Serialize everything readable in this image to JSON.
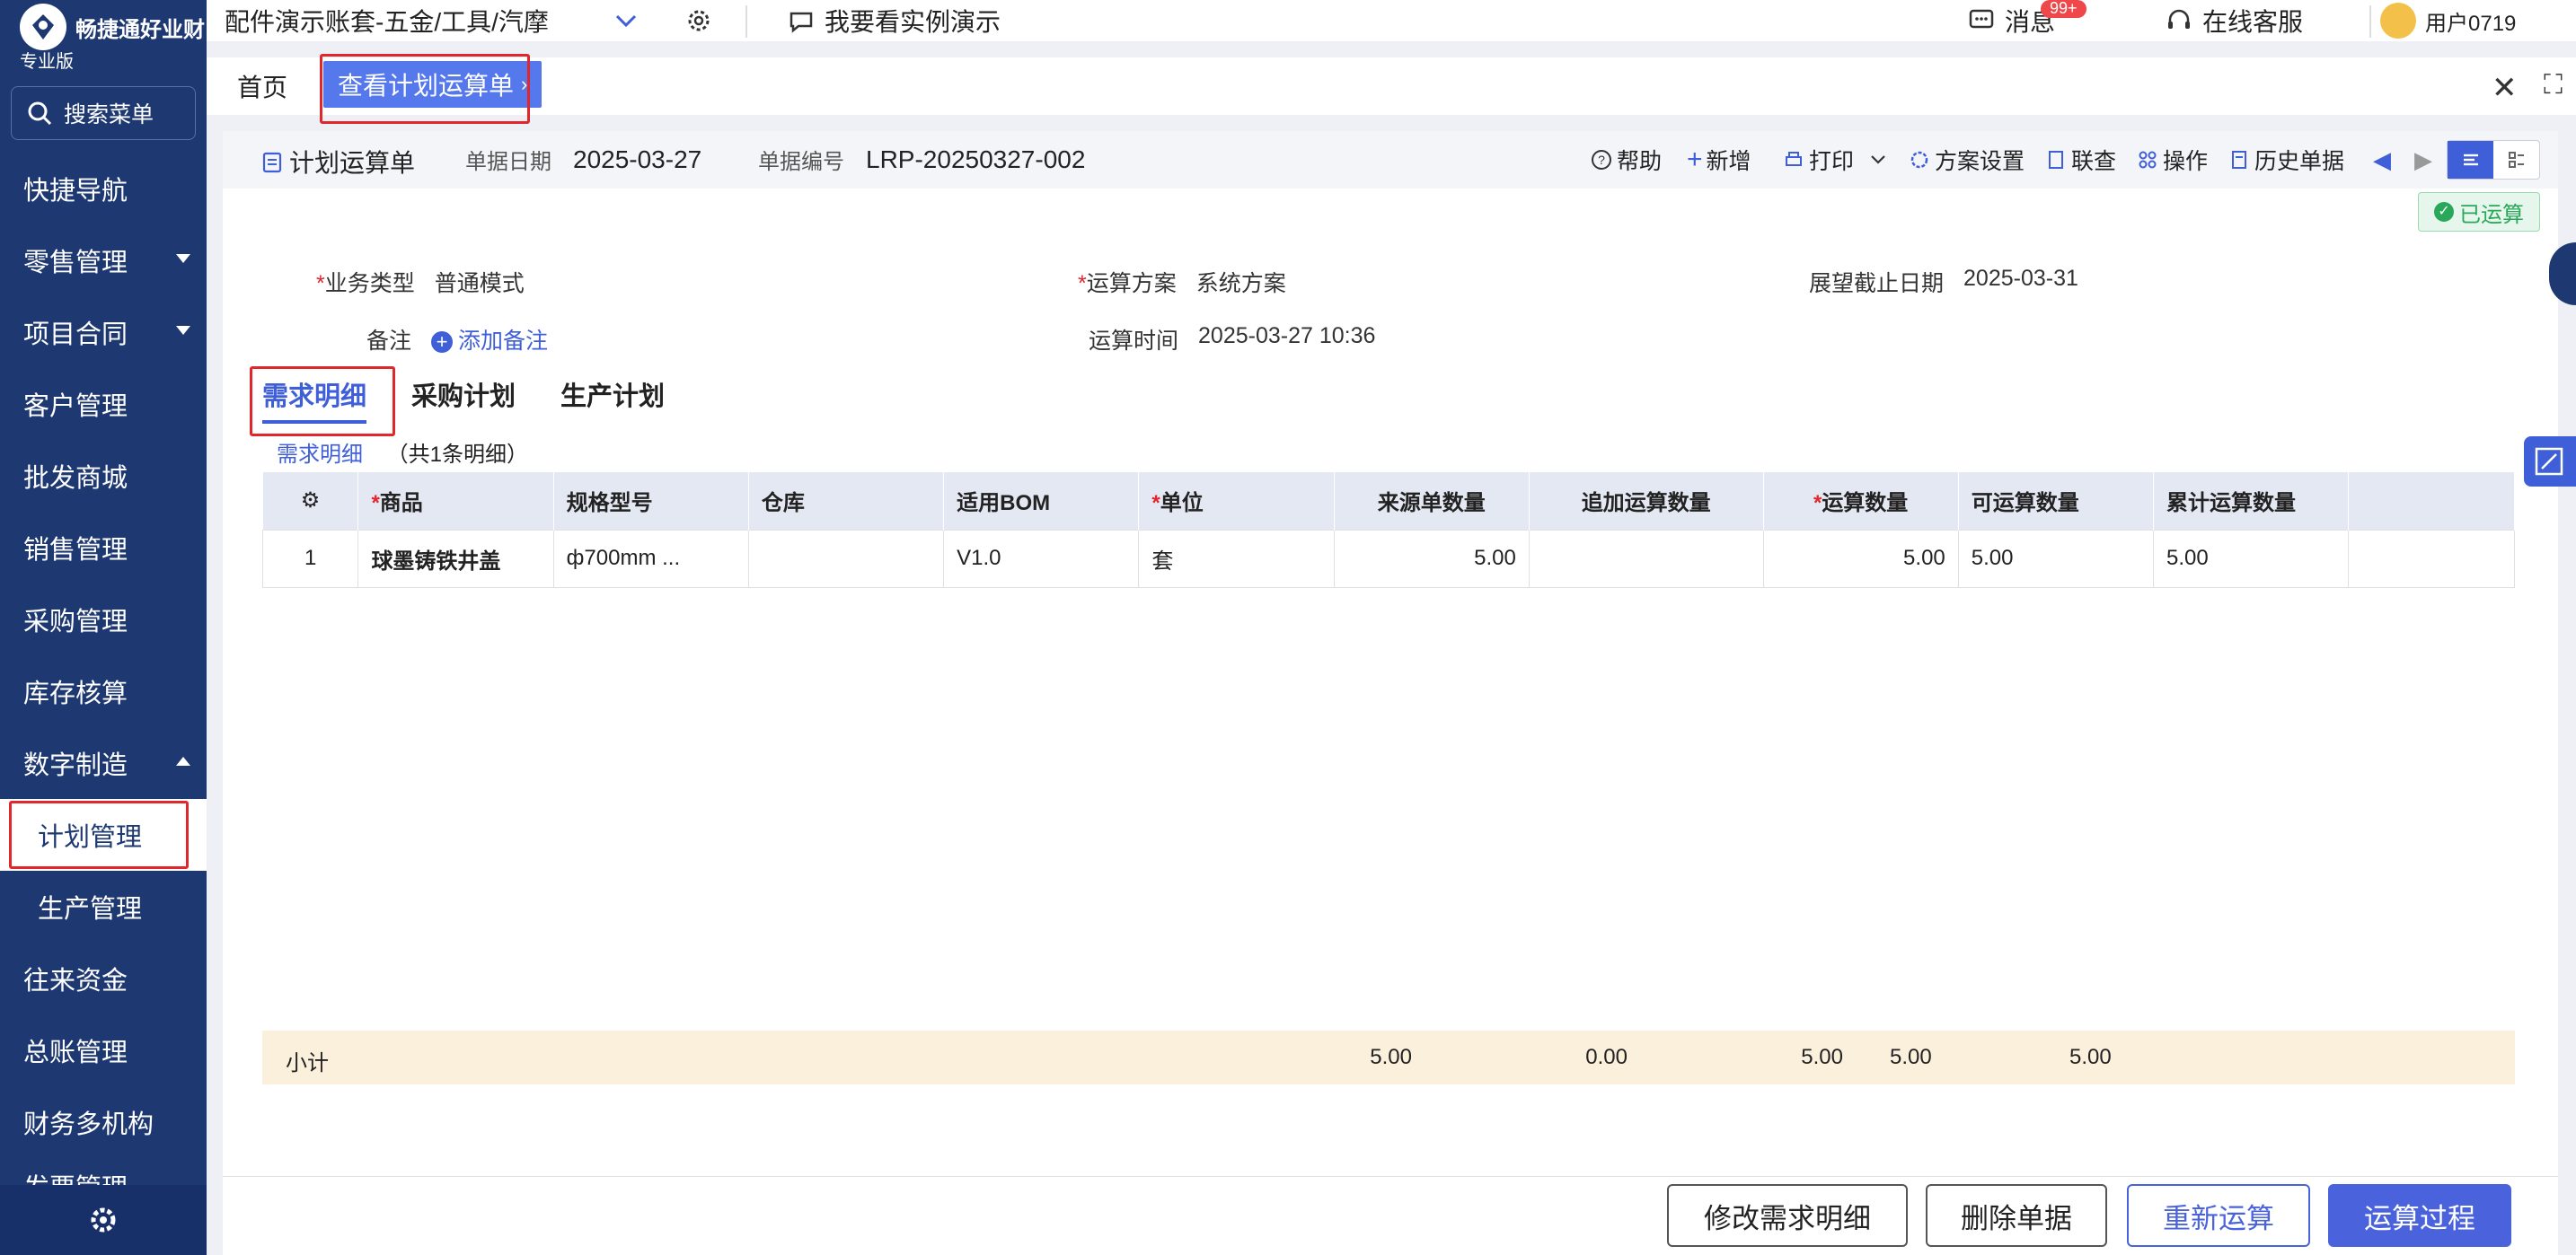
{
  "brand": {
    "name": "畅捷通好业财",
    "edition": "专业版"
  },
  "sidebar": {
    "search_label": "搜索菜单",
    "items": [
      {
        "label": "快捷导航"
      },
      {
        "label": "零售管理"
      },
      {
        "label": "项目合同"
      },
      {
        "label": "客户管理"
      },
      {
        "label": "批发商城"
      },
      {
        "label": "销售管理"
      },
      {
        "label": "采购管理"
      },
      {
        "label": "库存核算"
      },
      {
        "label": "数字制造"
      },
      {
        "label": "计划管理"
      },
      {
        "label": "生产管理"
      },
      {
        "label": "往来资金"
      },
      {
        "label": "总账管理"
      },
      {
        "label": "财务多机构"
      },
      {
        "label": "发票管理"
      }
    ]
  },
  "topbar": {
    "account": "配件演示账套-五金/工具/汽摩",
    "demo": "我要看实例演示",
    "messages": "消息",
    "message_badge": "99+",
    "service": "在线客服",
    "user": "用户0719"
  },
  "tabs": {
    "home": "首页",
    "active": "查看计划运算单"
  },
  "header": {
    "doc_title": "计划运算单",
    "date_label": "单据日期",
    "date": "2025-03-27",
    "no_label": "单据编号",
    "no": "LRP-20250327-002"
  },
  "toolbar": {
    "help": "帮助",
    "add": "新增",
    "print": "打印",
    "scheme": "方案设置",
    "lookup": "联查",
    "ops": "操作",
    "history": "历史单据"
  },
  "status": "已运算",
  "form": {
    "biz_type_label": "业务类型",
    "biz_type": "普通模式",
    "scheme_label": "运算方案",
    "scheme": "系统方案",
    "deadline_label": "展望截止日期",
    "deadline": "2025-03-31",
    "remark_label": "备注",
    "add_remark": "添加备注",
    "calc_time_label": "运算时间",
    "calc_time": "2025-03-27 10:36"
  },
  "subtabs": [
    "需求明细",
    "采购计划",
    "生产计划"
  ],
  "detail": {
    "link": "需求明细",
    "count_prefix": "（共",
    "count": "1",
    "count_suffix": "条明细）"
  },
  "table": {
    "columns": [
      "商品",
      "规格型号",
      "仓库",
      "适用BOM",
      "单位",
      "来源单数量",
      "追加运算数量",
      "运算数量",
      "可运算数量",
      "累计运算数量"
    ],
    "rows": [
      {
        "idx": "1",
        "product": "球墨铸铁井盖",
        "spec": "ф700mm ...",
        "warehouse": "",
        "bom": "V1.0",
        "unit": "套",
        "src_qty": "5.00",
        "add_qty": "",
        "calc_qty": "5.00",
        "avail_qty": "5.00",
        "cum_qty": "5.00"
      }
    ],
    "subtotal": {
      "label": "小计",
      "src_qty": "5.00",
      "add_qty": "0.00",
      "calc_qty": "5.00",
      "avail_qty": "5.00",
      "cum_qty": "5.00"
    }
  },
  "footer": {
    "edit": "修改需求明细",
    "delete": "删除单据",
    "recalc": "重新运算",
    "process": "运算过程"
  },
  "colors": {
    "sidebar": "#1e3872",
    "primary": "#4a63dc",
    "highlight": "#e0272c"
  }
}
